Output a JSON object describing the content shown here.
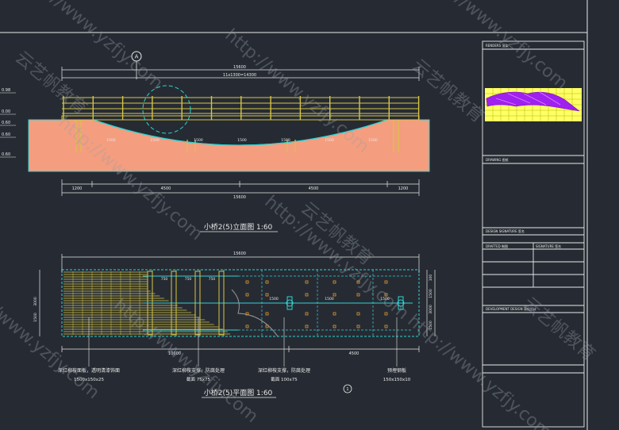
{
  "drawing": {
    "elevation_title": "小桥2(5)立面图 1:60",
    "plan_title": "小桥2(5)平面图 1:60",
    "section_marker_letter": "A",
    "section_marker_number": "1"
  },
  "elevation": {
    "overall_dim_top": "15600",
    "sub_dim_top": "11x1300=14300",
    "bottom_dims": [
      "1200",
      "4500",
      "4500",
      "1200"
    ],
    "overall_dim_bottom": "15600",
    "inner_dims": [
      "1500",
      "1500",
      "1500",
      "1500",
      "1500",
      "1500",
      "1500"
    ],
    "left_levels": [
      "0.98",
      "0.00",
      "0.60",
      "0.60",
      "0.60"
    ]
  },
  "plan": {
    "overall_dim_top": "15600",
    "top_dims": [
      "750",
      "750",
      "750"
    ],
    "inner_dims": [
      "1500",
      "1500",
      "1500"
    ],
    "left_dims": [
      "1500",
      "3000"
    ],
    "right_dims": [
      "100",
      "1500",
      "3000",
      "1500"
    ],
    "bottom_dims": [
      "10000",
      "4500"
    ],
    "annotations": [
      {
        "line1": "深红柳桉面板，透明清漆饰面",
        "line2": "1500x150x25"
      },
      {
        "line1": "深红柳桉支撑，防腐处理",
        "line2": "截面 75x75"
      },
      {
        "line1": "深红柳桉支撑，防腐处理",
        "line2": "截面 100x75"
      },
      {
        "line1": "预埋钢板",
        "line2": "150x150x10"
      }
    ]
  },
  "title_block": {
    "labels": [
      "RENDERS 渲染",
      "DRAWING 图纸",
      "DESIGN SIGNATURE 签名",
      "DRAFTED 制图",
      "SIGNATURE 签名",
      "DEVELOPMENT DESIGN 深化设计"
    ]
  },
  "watermarks": [
    "http://www.yzfjy.com",
    "云艺帆教育"
  ],
  "colors": {
    "background": "#262b33",
    "ground": "#f59d7f",
    "rail": "#d5c445",
    "cyan": "#2fd3d3",
    "dim_lines": "#e8e8e8",
    "purple_render": "#a020f0",
    "render_bg": "#ffff66"
  }
}
